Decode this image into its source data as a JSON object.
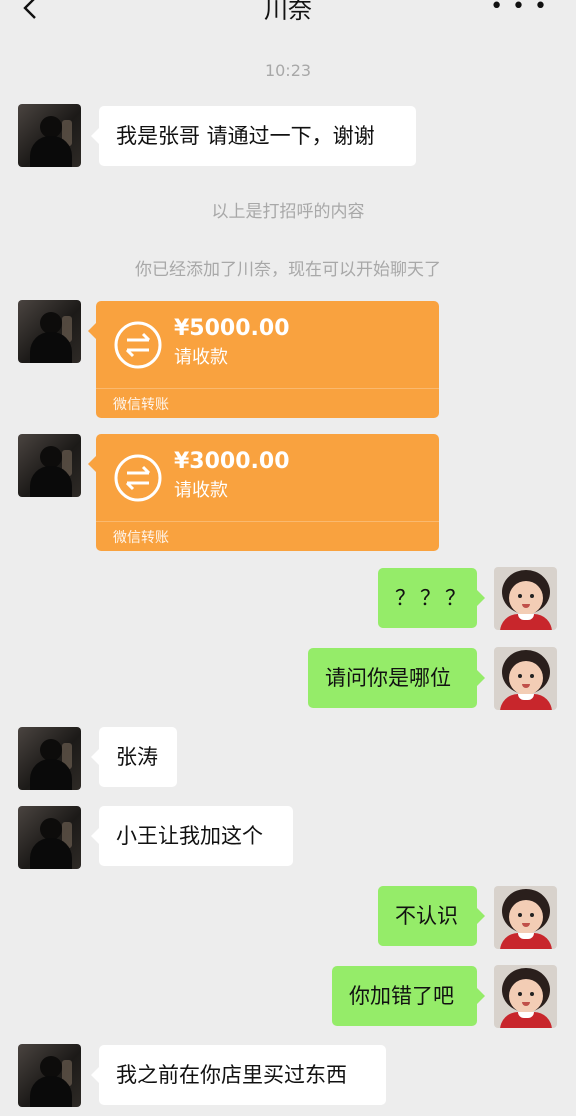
{
  "header": {
    "title": "川奈",
    "more": "• • •"
  },
  "system": {
    "time": "10:23",
    "greeting_note": "以上是打招呼的内容",
    "added_note": "你已经添加了川奈，现在可以开始聊天了"
  },
  "messages": {
    "m1": "我是张哥 请通过一下，谢谢",
    "transfer1": {
      "amount": "¥5000.00",
      "status": "请收款",
      "footer": "微信转账"
    },
    "transfer2": {
      "amount": "¥3000.00",
      "status": "请收款",
      "footer": "微信转账"
    },
    "m4": "？？？",
    "m5": "请问你是哪位",
    "m6": "张涛",
    "m7": "小王让我加这个",
    "m8": "不认识",
    "m9": "你加错了吧",
    "m10": "我之前在你店里买过东西"
  },
  "colors": {
    "background": "#ededed",
    "out_bubble": "#95ec69",
    "in_bubble": "#ffffff",
    "transfer": "#f9a23f"
  }
}
